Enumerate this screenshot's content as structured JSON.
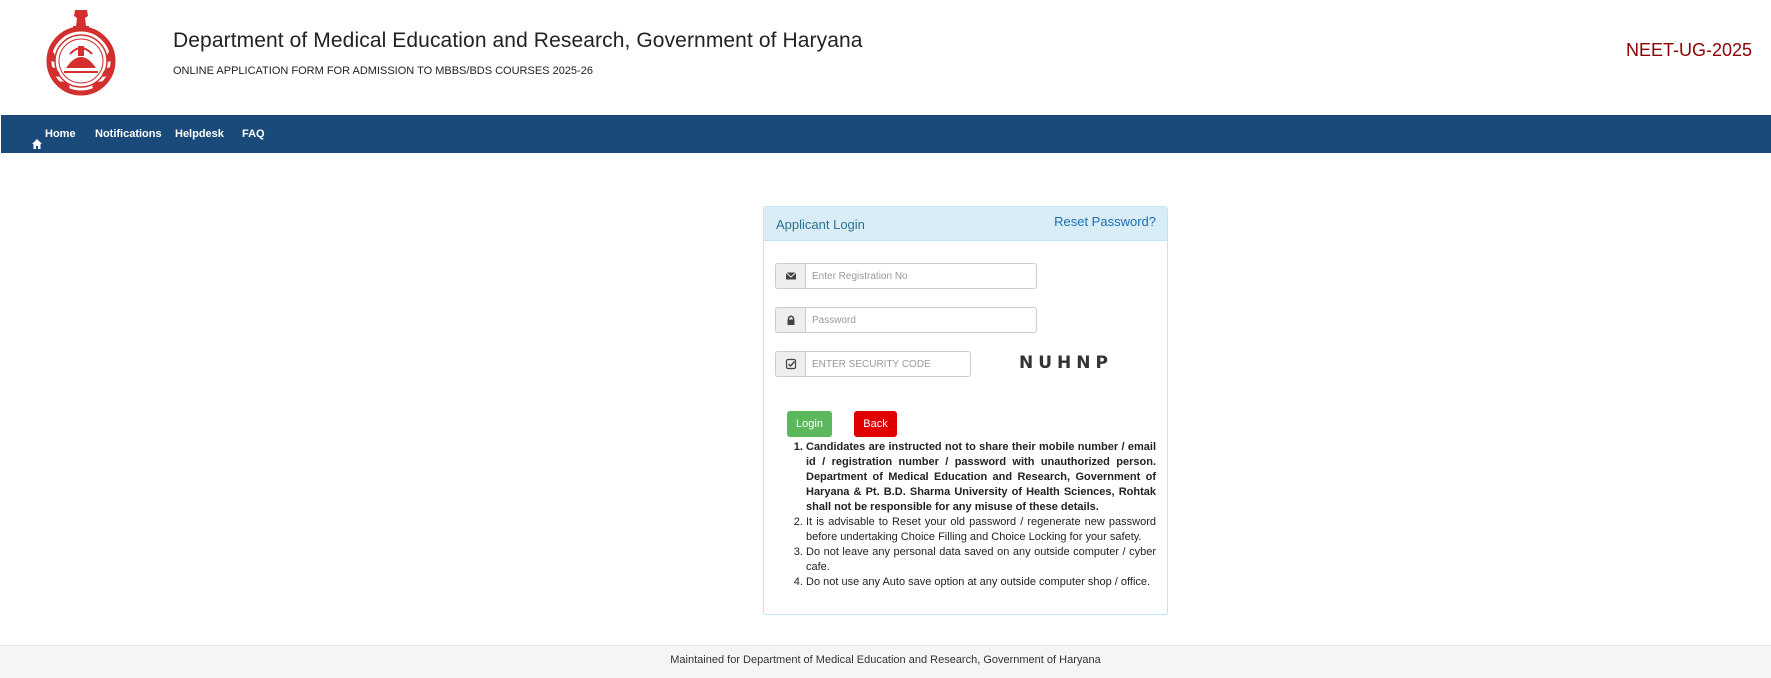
{
  "header": {
    "title": "Department of Medical Education and Research, Government of Haryana",
    "subtitle": "ONLINE APPLICATION FORM FOR ADMISSION TO MBBS/BDS COURSES 2025-26",
    "exam": "NEET-UG-2025"
  },
  "nav": {
    "items": [
      {
        "label": "Home",
        "icon": "home-icon"
      },
      {
        "label": "Notifications"
      },
      {
        "label": "Helpdesk"
      },
      {
        "label": "FAQ"
      }
    ]
  },
  "login": {
    "title": "Applicant Login",
    "reset_link": "Reset Password?",
    "registration_placeholder": "Enter Registration No",
    "password_placeholder": "Password",
    "security_placeholder": "ENTER SECURITY CODE",
    "captcha": "NUHNP",
    "login_label": "Login",
    "back_label": "Back"
  },
  "notes": [
    "Candidates are instructed not to share their mobile number / email id / registration number / password with unauthorized person. Department of Medical Education and Research, Government of Haryana & Pt. B.D. Sharma University of Health Sciences, Rohtak shall not be responsible for any misuse of these details.",
    "It is advisable to Reset your old password / regenerate new password before undertaking Choice Filling and Choice Locking for your safety.",
    "Do not leave any personal data saved on any outside computer / cyber cafe.",
    "Do not use any Auto save option at any outside computer shop / office."
  ],
  "footer": {
    "text": "Maintained for Department of Medical Education and Research, Government of Haryana"
  },
  "colors": {
    "navbar": "#1a4a7a",
    "exam_text": "#8b0000",
    "login_button": "#5cb85c",
    "back_button": "#e10000",
    "panel_header": "#d9edf7"
  }
}
